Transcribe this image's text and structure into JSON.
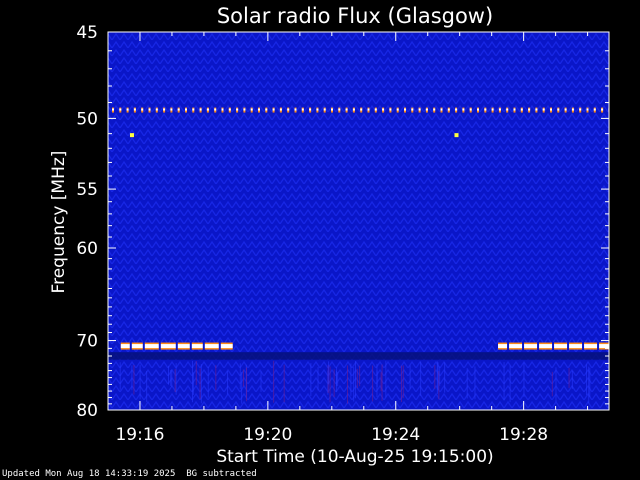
{
  "chart_data": {
    "type": "heatmap",
    "title": "Solar radio Flux (Glasgow)",
    "xlabel": "Start Time (10-Aug-25 19:15:00)",
    "ylabel": "Frequency [MHz]",
    "x_start": "19:15:00",
    "x_end": "19:30:40",
    "xticks": [
      "19:16",
      "19:20",
      "19:24",
      "19:28"
    ],
    "xtick_minutes": [
      1,
      5,
      9,
      13
    ],
    "x_range_minutes": [
      0,
      15.67
    ],
    "yticks": [
      45,
      50,
      55,
      60,
      70,
      80
    ],
    "ylim": [
      45,
      80
    ],
    "y_scale": "reciprocal",
    "colors": {
      "background": "#0a16c8",
      "texture": "#1d2ff0",
      "dark_band": "#06107a",
      "hot": "#ffffff",
      "warm": "#ff8c1a",
      "spike": "#7a1f8c"
    },
    "features": [
      {
        "name": "dotted interference line",
        "frequency_mhz": 49.5,
        "minutes": [
          0,
          15.67
        ]
      },
      {
        "name": "interference band segment",
        "frequency_mhz": 70.7,
        "minutes": [
          0.4,
          3.9
        ]
      },
      {
        "name": "interference band segment",
        "frequency_mhz": 70.7,
        "minutes": [
          12.2,
          15.67
        ]
      },
      {
        "name": "isolated dot",
        "frequency_mhz": 51.1,
        "minutes": 0.75
      },
      {
        "name": "isolated dot",
        "frequency_mhz": 51.1,
        "minutes": 10.9
      }
    ]
  },
  "footer": {
    "updated": "Updated Mon Aug 18 14:33:19 2025",
    "mode": "BG subtracted"
  }
}
